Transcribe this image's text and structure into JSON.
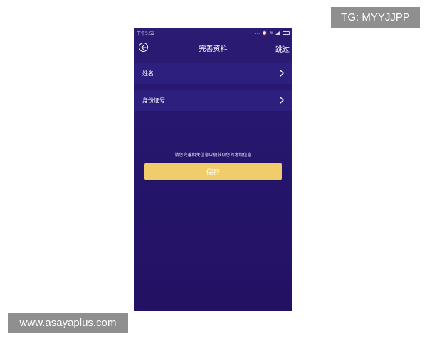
{
  "watermarks": {
    "tg": "TG: MYYJJPP",
    "site": "www.asayaplus.com"
  },
  "status_bar": {
    "time": "下午5:52",
    "icons_text": "... ⏰ ≋"
  },
  "header": {
    "title": "完善资料",
    "skip_label": "跳过"
  },
  "form": {
    "rows": [
      {
        "label": "姓名"
      },
      {
        "label": "身份证号"
      }
    ]
  },
  "hint": "请您完善相关信息以便获取您的考级信息",
  "save_label": "保存",
  "colors": {
    "background": "#24146a",
    "row_bg": "#2d1f7e",
    "accent_button": "#f0cc6b",
    "divider": "#b09a6a"
  }
}
